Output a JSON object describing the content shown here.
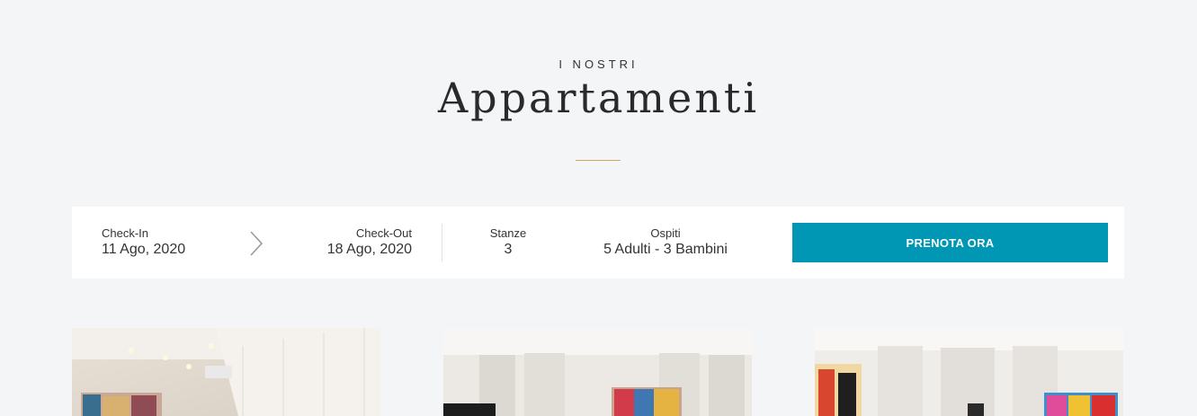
{
  "section": {
    "eyebrow": "I NOSTRI",
    "title": "Appartamenti",
    "divider_color": "#d4a65a"
  },
  "booking": {
    "check_in": {
      "label": "Check-In",
      "value": "11 Ago, 2020"
    },
    "check_out": {
      "label": "Check-Out",
      "value": "18 Ago, 2020"
    },
    "rooms": {
      "label": "Stanze",
      "value": "3"
    },
    "guests": {
      "label": "Ospiti",
      "value": "5 Adulti - 3 Bambini"
    },
    "cta_label": "PRENOTA ORA",
    "cta_color": "#0097b5",
    "arrow_icon": "chevron-right-icon"
  },
  "apartments": [
    {
      "image": "apartment-photo-1"
    },
    {
      "image": "apartment-photo-2"
    },
    {
      "image": "apartment-photo-3"
    }
  ]
}
